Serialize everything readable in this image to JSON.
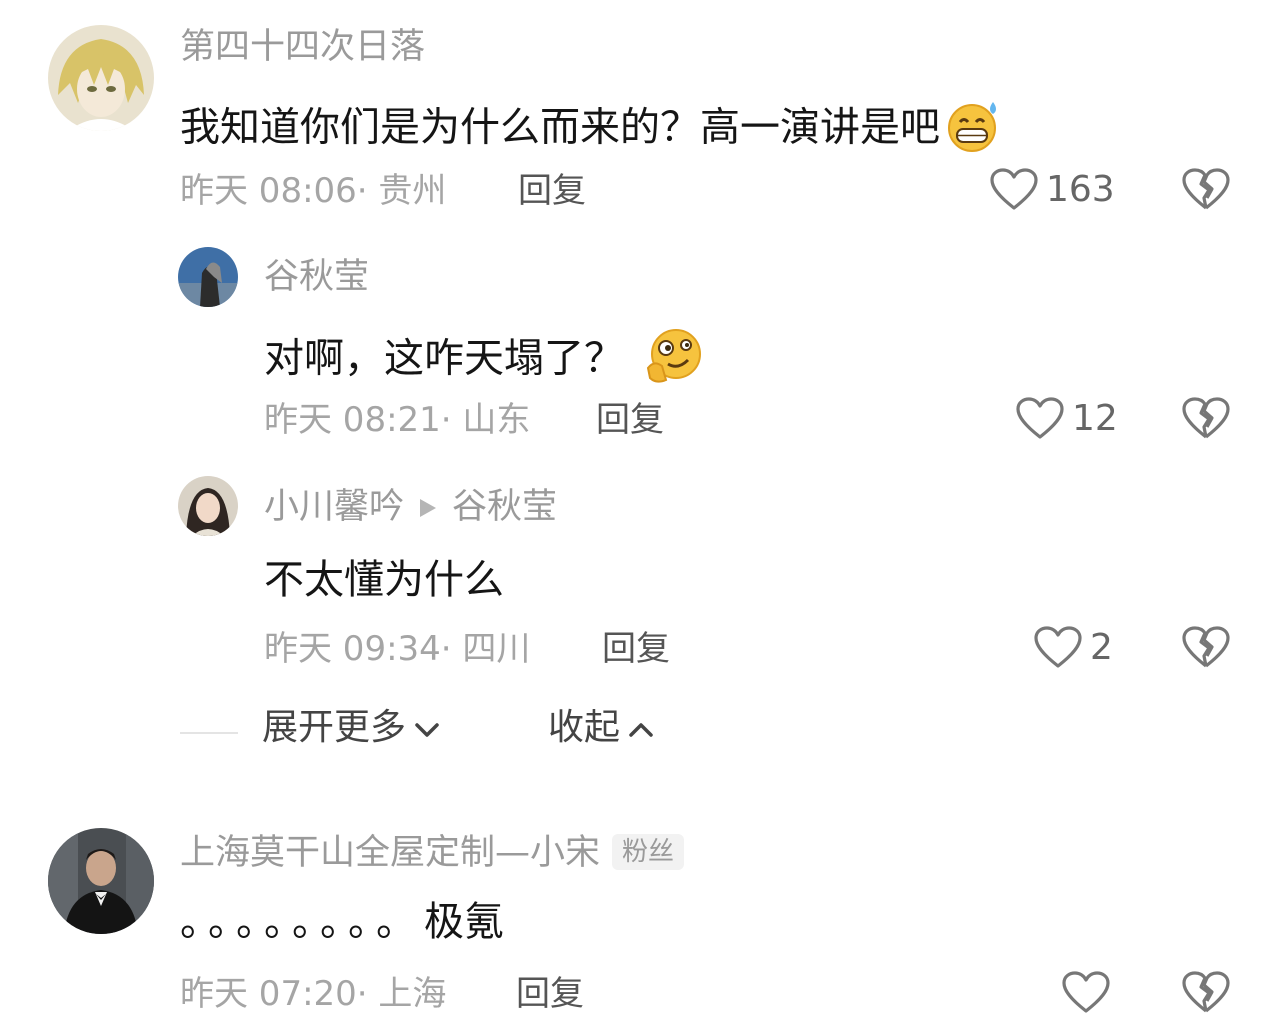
{
  "comments": [
    {
      "username": "第四十四次日落",
      "text": "我知道你们是为什么而来的？高一演讲是吧",
      "emoji": "grinning-sweat-emoji",
      "time": "昨天 08:06",
      "location": "贵州",
      "reply_label": "回复",
      "likes": "163"
    },
    {
      "username": "谷秋莹",
      "text": "对啊，这咋天塌了？",
      "emoji": "zany-thinking-emoji",
      "time": "昨天 08:21",
      "location": "山东",
      "reply_label": "回复",
      "likes": "12"
    },
    {
      "username": "小川馨吟",
      "reply_to": "谷秋莹",
      "text": "不太懂为什么",
      "time": "昨天 09:34",
      "location": "四川",
      "reply_label": "回复",
      "likes": "2"
    },
    {
      "username": "上海莫干山全屋定制—小宋",
      "badge": "粉丝",
      "text_dots": "。。。。。。。。",
      "text": "极氪",
      "time": "昨天 07:20",
      "location": "上海",
      "reply_label": "回复",
      "likes": ""
    }
  ],
  "thread": {
    "expand_label": "展开更多",
    "collapse_label": "收起"
  },
  "colors": {
    "username": "#9a9a9a",
    "meta": "#a5a5a5",
    "text": "#151515"
  }
}
